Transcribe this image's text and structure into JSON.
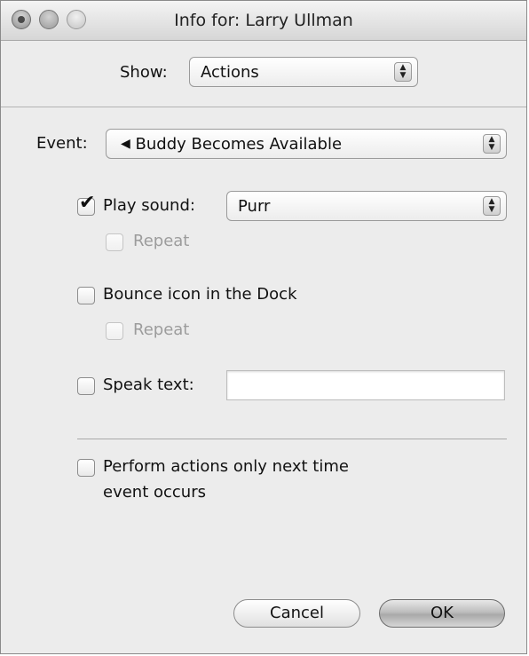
{
  "window": {
    "title": "Info for: Larry Ullman"
  },
  "show": {
    "label": "Show:",
    "selected": "Actions"
  },
  "event": {
    "label": "Event:",
    "icon": "speaker-icon",
    "selected": "Buddy Becomes Available"
  },
  "play_sound": {
    "label": "Play sound:",
    "checked": true,
    "selected": "Purr",
    "repeat_label": "Repeat"
  },
  "bounce": {
    "label": "Bounce icon in the Dock",
    "checked": false,
    "repeat_label": "Repeat"
  },
  "speak": {
    "label": "Speak text:",
    "checked": false,
    "value": ""
  },
  "perform_once": {
    "line1": "Perform actions only next time",
    "line2": "event occurs",
    "checked": false
  },
  "buttons": {
    "cancel": "Cancel",
    "ok": "OK"
  }
}
